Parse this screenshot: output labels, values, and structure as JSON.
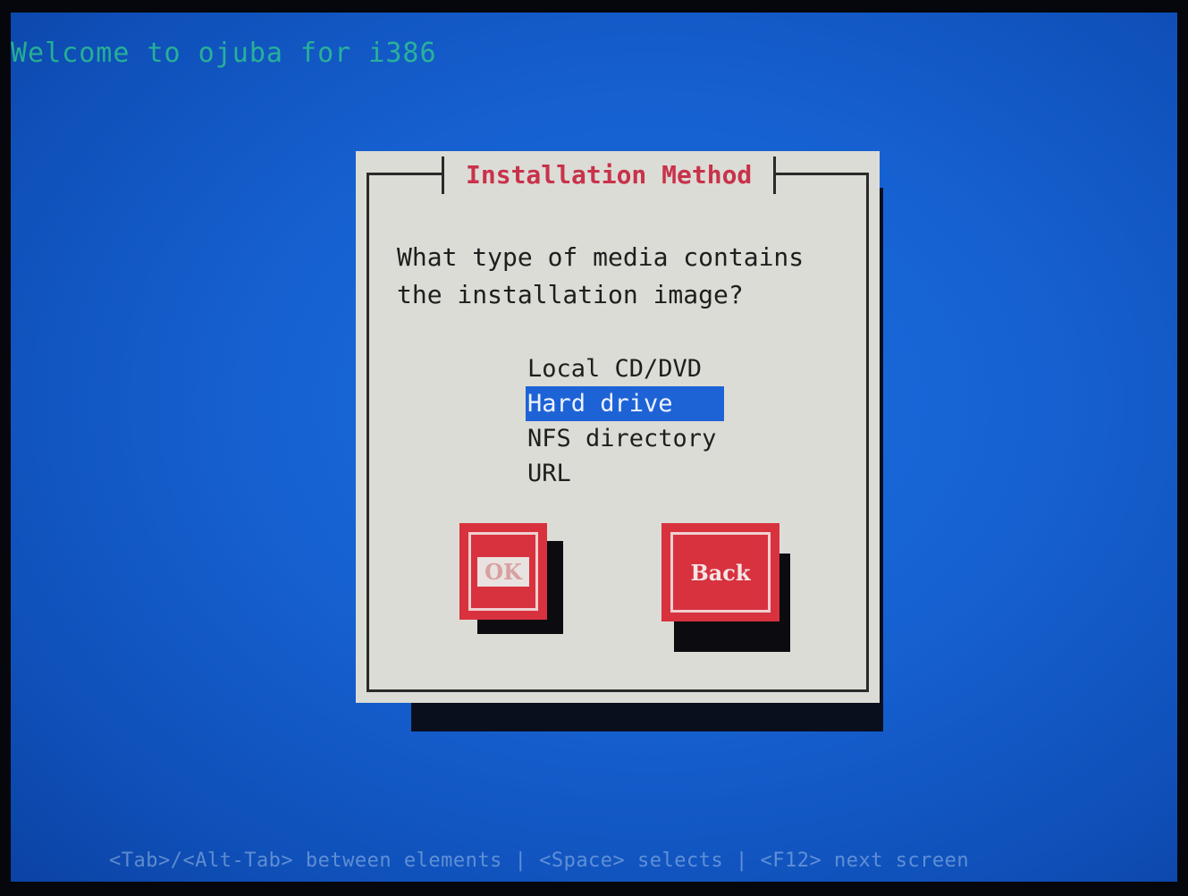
{
  "screen": {
    "welcome_text": "Welcome to ojuba for i386"
  },
  "dialog": {
    "title": "Installation Method",
    "prompt": "What type of media contains\nthe installation image?",
    "options": [
      {
        "label": "Local CD/DVD",
        "selected": false
      },
      {
        "label": "Hard drive",
        "selected": true
      },
      {
        "label": "NFS directory",
        "selected": false
      },
      {
        "label": "URL",
        "selected": false
      }
    ],
    "ok_label": "OK",
    "back_label": "Back"
  },
  "statusbar": {
    "text": "<Tab>/<Alt-Tab> between elements  |  <Space> selects  |  <F12> next screen"
  },
  "colors": {
    "background": "#1660d0",
    "dialog": "#dcdcd6",
    "title": "#c8324a",
    "selection": "#1e63d6",
    "button": "#d8323f"
  }
}
